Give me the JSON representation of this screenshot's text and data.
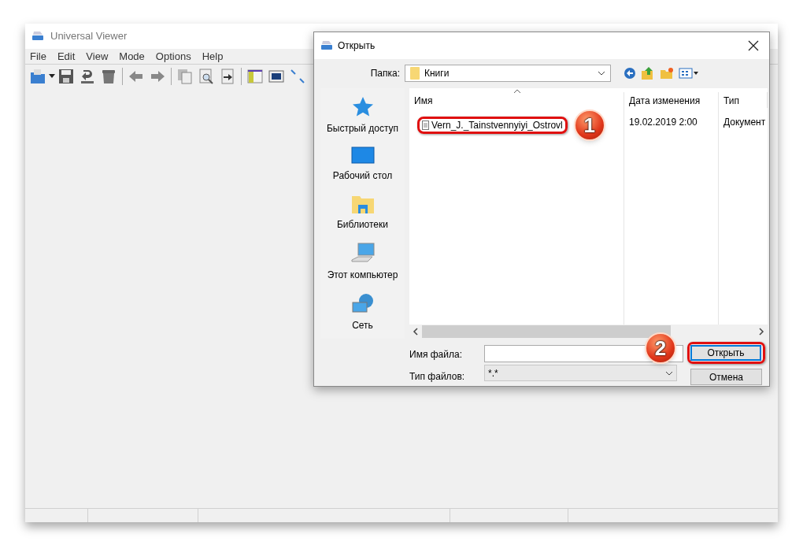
{
  "app": {
    "title": "Universal Viewer",
    "menu": [
      "File",
      "Edit",
      "View",
      "Mode",
      "Options",
      "Help"
    ]
  },
  "dialog": {
    "title": "Открыть",
    "folder_label": "Папка:",
    "folder": "Книги",
    "places": [
      {
        "label": "Быстрый доступ",
        "kind": "star"
      },
      {
        "label": "Рабочий стол",
        "kind": "desktop"
      },
      {
        "label": "Библиотеки",
        "kind": "library"
      },
      {
        "label": "Этот компьютер",
        "kind": "computer"
      },
      {
        "label": "Сеть",
        "kind": "network"
      }
    ],
    "columns": [
      "Имя",
      "Дата изменения",
      "Тип"
    ],
    "files": [
      {
        "name": "Vern_J._Tainstvennyiyi_Ostrovl",
        "date": "19.02.2019 2:00",
        "type": "Документ"
      }
    ],
    "file_name_label": "Имя файла:",
    "file_type_label": "Тип файлов:",
    "file_type": "*.*",
    "open_button": "Открыть",
    "cancel_button": "Отмена"
  },
  "callouts": [
    "1",
    "2"
  ]
}
